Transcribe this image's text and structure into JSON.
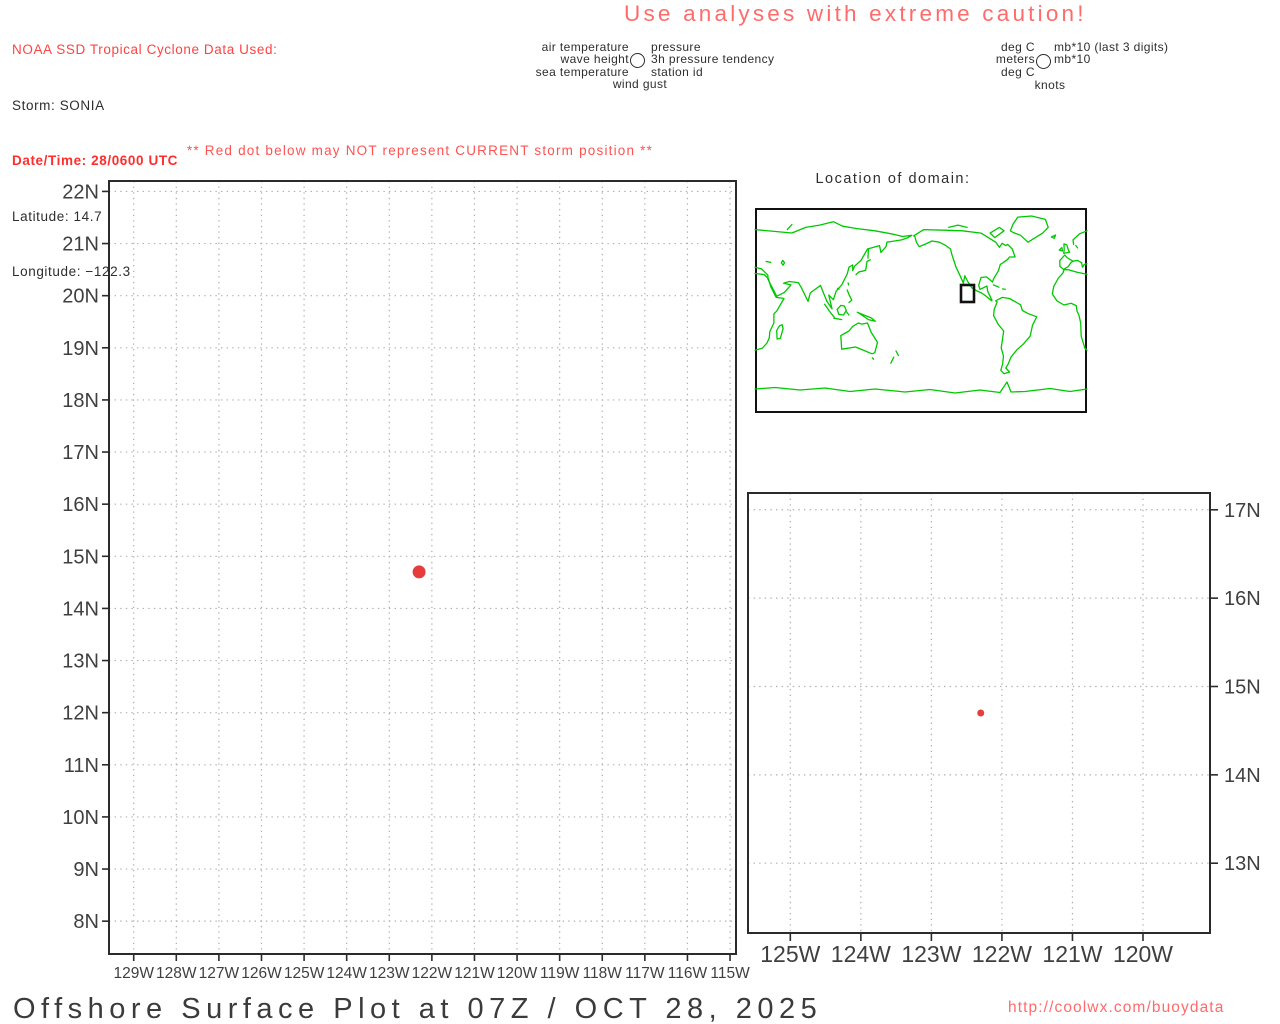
{
  "header": {
    "data_source_line": "NOAA SSD Tropical Cyclone Data Used:",
    "storm_line": "Storm: SONIA",
    "datetime_line": "Date/Time: 28/0600 UTC",
    "latitude_line": "Latitude: 14.7",
    "longitude_line": "Longitude: −122.3",
    "caution_title": "Use analyses with extreme caution!"
  },
  "station_model_legend": {
    "left": [
      "air temperature",
      "wave height",
      "sea temperature"
    ],
    "right": [
      "pressure",
      "3h pressure tendency",
      "station id"
    ],
    "bottom": "wind gust"
  },
  "units_legend": {
    "left": [
      "deg C",
      "meters",
      "deg C"
    ],
    "right": [
      "mb*10 (last 3 digits)",
      "mb*10",
      ""
    ],
    "bottom": "knots"
  },
  "warning_note": "** Red dot below may NOT represent CURRENT storm position **",
  "inset_map": {
    "title": "Location of domain:"
  },
  "footer": {
    "title": "Offshore Surface Plot at 07Z / OCT 28, 2025",
    "url": "http://coolwx.com/buoydata"
  },
  "storm": {
    "name": "SONIA",
    "datetime_utc": "28/0600",
    "lat": 14.7,
    "lon": -122.3
  },
  "chart_data": [
    {
      "type": "scatter",
      "name": "main-domain-plot",
      "title": "",
      "xlabel": "",
      "ylabel": "",
      "grid": "dotted",
      "xlim": [
        -129.58,
        -114.86
      ],
      "ylim": [
        7.37,
        22.2
      ],
      "x_ticks": [
        {
          "v": -129,
          "label": "129W"
        },
        {
          "v": -128,
          "label": "128W"
        },
        {
          "v": -127,
          "label": "127W"
        },
        {
          "v": -126,
          "label": "126W"
        },
        {
          "v": -125,
          "label": "125W"
        },
        {
          "v": -124,
          "label": "124W"
        },
        {
          "v": -123,
          "label": "123W"
        },
        {
          "v": -122,
          "label": "122W"
        },
        {
          "v": -121,
          "label": "121W"
        },
        {
          "v": -120,
          "label": "120W"
        },
        {
          "v": -119,
          "label": "119W"
        },
        {
          "v": -118,
          "label": "118W"
        },
        {
          "v": -117,
          "label": "117W"
        },
        {
          "v": -116,
          "label": "116W"
        },
        {
          "v": -115,
          "label": "115W"
        }
      ],
      "y_ticks": [
        {
          "v": 22,
          "label": "22N"
        },
        {
          "v": 21,
          "label": "21N"
        },
        {
          "v": 20,
          "label": "20N"
        },
        {
          "v": 19,
          "label": "19N"
        },
        {
          "v": 18,
          "label": "18N"
        },
        {
          "v": 17,
          "label": "17N"
        },
        {
          "v": 16,
          "label": "16N"
        },
        {
          "v": 15,
          "label": "15N"
        },
        {
          "v": 14,
          "label": "14N"
        },
        {
          "v": 13,
          "label": "13N"
        },
        {
          "v": 12,
          "label": "12N"
        },
        {
          "v": 11,
          "label": "11N"
        },
        {
          "v": 10,
          "label": "10N"
        },
        {
          "v": 9,
          "label": "9N"
        },
        {
          "v": 8,
          "label": "8N"
        }
      ],
      "points": [
        {
          "lon": -122.3,
          "lat": 14.7
        }
      ]
    },
    {
      "type": "scatter",
      "name": "zoom-domain-plot",
      "title": "",
      "xlabel": "",
      "ylabel": "",
      "grid": "dotted",
      "xlim": [
        -125.6,
        -119.05
      ],
      "ylim": [
        12.21,
        17.19
      ],
      "x_ticks": [
        {
          "v": -125,
          "label": "125W"
        },
        {
          "v": -124,
          "label": "124W"
        },
        {
          "v": -123,
          "label": "123W"
        },
        {
          "v": -122,
          "label": "122W"
        },
        {
          "v": -121,
          "label": "121W"
        },
        {
          "v": -120,
          "label": "120W"
        }
      ],
      "y_ticks": [
        {
          "v": 17,
          "label": "17N"
        },
        {
          "v": 16,
          "label": "16N"
        },
        {
          "v": 15,
          "label": "15N"
        },
        {
          "v": 14,
          "label": "14N"
        },
        {
          "v": 13,
          "label": "13N"
        }
      ],
      "points": [
        {
          "lon": -122.3,
          "lat": 14.7
        }
      ]
    }
  ],
  "colors": {
    "accent_red": "#ff4343",
    "bold_red": "#ff2d2d",
    "soft_red": "#ff6b6b",
    "warning_red": "#ff5252",
    "storm_dot": "#e63c3c",
    "map_green": "#00c800",
    "frame": "#2b2b2b",
    "grid": "#b0b0b0",
    "label": "#3f3f3f",
    "text": "#2e2e2e"
  }
}
